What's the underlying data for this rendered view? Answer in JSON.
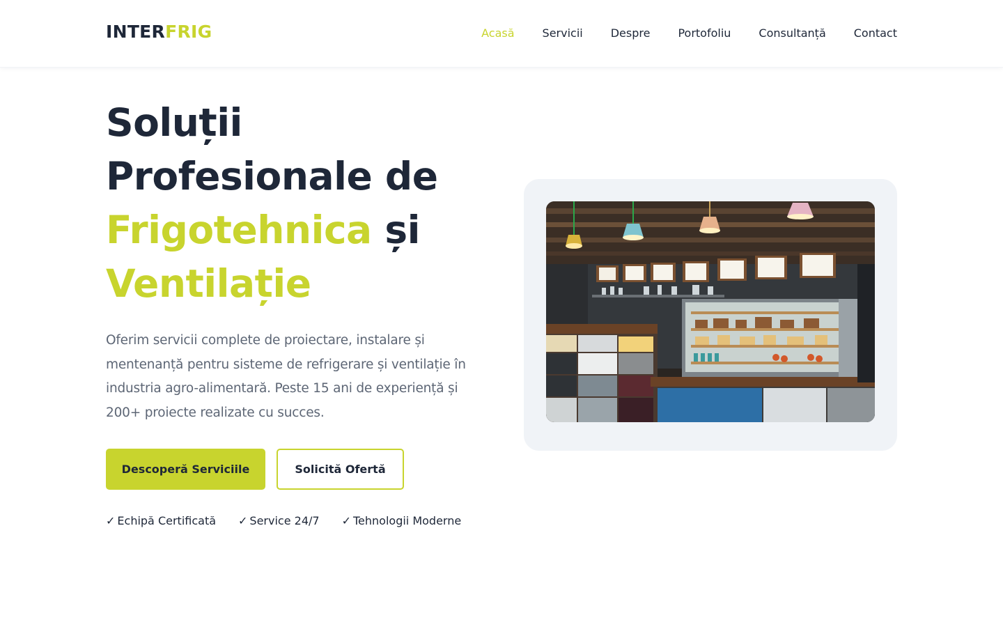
{
  "header": {
    "logo_part1": "INTER",
    "logo_part2": "FRIG",
    "nav": [
      {
        "label": "Acasă",
        "active": true
      },
      {
        "label": "Servicii",
        "active": false
      },
      {
        "label": "Despre",
        "active": false
      },
      {
        "label": "Portofoliu",
        "active": false
      },
      {
        "label": "Consultanță",
        "active": false
      },
      {
        "label": "Contact",
        "active": false
      }
    ]
  },
  "hero": {
    "title_line1": "Soluții",
    "title_line2": "Profesionale de",
    "title_accent1": "Frigotehnica",
    "title_conj": "și",
    "title_accent2": "Ventilație",
    "description": "Oferim servicii complete de proiectare, instalare și mentenanță pentru sisteme de refrigerare și ventilație în industria agro-alimentară. Peste 15 ani de experiență și 200+ proiecte realizate cu succes.",
    "primary_button": "Descoperă Serviciile",
    "secondary_button": "Solicită Ofertă",
    "check_symbol": "✓",
    "features": [
      "Echipă Certificată",
      "Service 24/7",
      "Tehnologii Moderne"
    ]
  },
  "colors": {
    "accent": "#c8d42e",
    "dark": "#1e2738",
    "muted_text": "#5d6675",
    "card_bg": "#f0f3f7"
  }
}
